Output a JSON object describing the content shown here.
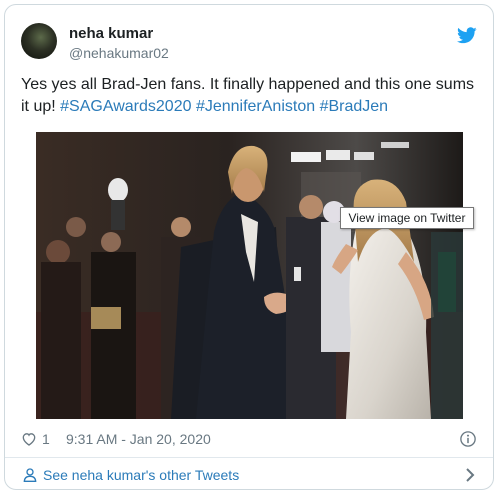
{
  "user": {
    "display_name": "neha kumar",
    "handle": "@nehakumar02"
  },
  "tweet": {
    "text_plain": "Yes yes all Brad-Jen fans. It finally happened and this one sums it  up! ",
    "hashtags": [
      "#SAGAwards2020",
      "#JenniferAniston",
      "#BradJen"
    ]
  },
  "media": {
    "tooltip": "View image on Twitter"
  },
  "meta": {
    "like_count": "1",
    "timestamp": "9:31 AM - Jan 20, 2020"
  },
  "footer": {
    "label": "See neha kumar's other Tweets"
  },
  "colors": {
    "link": "#2b7bb9",
    "text": "#1c2022",
    "muted": "#697882",
    "twitter_blue": "#1da1f2",
    "border": "#cfd9de"
  },
  "icons": {
    "brand": "twitter-bird-icon",
    "like": "heart-icon",
    "info": "info-icon",
    "profile": "person-icon",
    "more": "chevron-right-icon"
  }
}
